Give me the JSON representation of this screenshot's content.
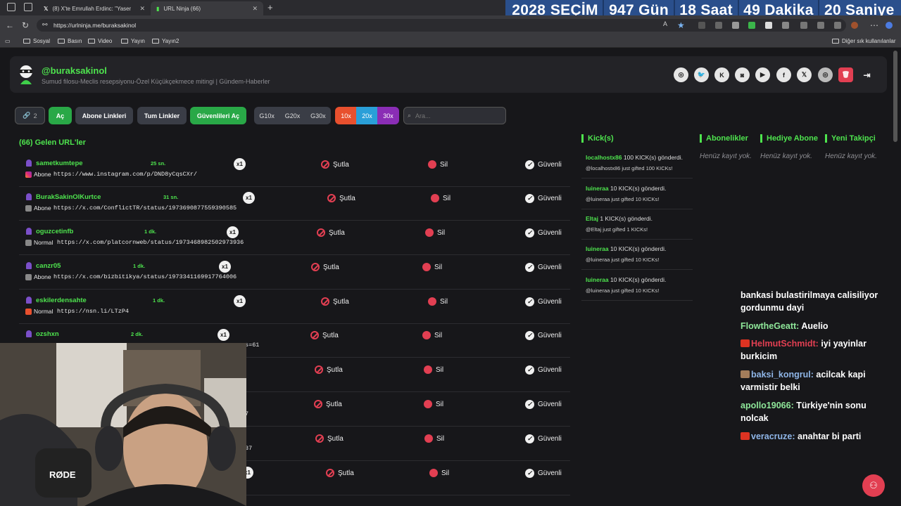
{
  "browser": {
    "tabs": [
      {
        "label": "(8) X'te Emrullah Erdinc: \"Yasemin",
        "active": false
      },
      {
        "label": "URL Ninja (66)",
        "active": true
      }
    ],
    "url": "https://urlninja.me/buraksakinol",
    "bookmarks": [
      "Sosyal",
      "Basın",
      "Video",
      "Yayın",
      "Yayın2"
    ],
    "other_bookmarks": "Diğer sık kullanılanlar"
  },
  "countdown": {
    "year": "2028",
    "label": "SEÇİM",
    "days": "947 Gün",
    "hours": "18 Saat",
    "minutes": "49 Dakika",
    "seconds": "20 Saniye"
  },
  "profile": {
    "username": "@buraksakinol",
    "subtitle": "Sumud filosu-Meclis resepsiyonu-Özel Küçükçekmece mitingi | Gündem-Haberler",
    "social_icons": [
      "dribbble-icon",
      "twitter-icon",
      "kick-icon",
      "instagram-icon",
      "youtube-icon",
      "facebook-icon",
      "x-icon",
      "dribbble-alt-icon",
      "trash-icon",
      "logout-icon"
    ]
  },
  "toolbar": {
    "count": "2",
    "open_label": "Aç",
    "subscriber_links": "Abone Linkleri",
    "all_links": "Tum Linkler",
    "open_safe": "Güvenlileri Aç",
    "g_options": [
      "G10x",
      "G20x",
      "G30x"
    ],
    "multipliers": [
      {
        "label": "10x",
        "color": "#e8502e"
      },
      {
        "label": "20x",
        "color": "#2a9fd8"
      },
      {
        "label": "30x",
        "color": "#8a2db5"
      }
    ],
    "search_placeholder": "Ara..."
  },
  "list": {
    "title": "(66) Gelen URL'ler",
    "actions": {
      "skip": "Şutla",
      "delete": "Sil",
      "safe": "Güvenli"
    },
    "rows": [
      {
        "user": "sametkumtepe",
        "time": "25 sn.",
        "mult": "x1",
        "kind": "Abone",
        "platform": "instagram",
        "url": "https://www.instagram.com/p/DND8yCqsCXr/"
      },
      {
        "user": "BurakSakinOlKurtce",
        "time": "31 sn.",
        "mult": "x1",
        "kind": "Abone",
        "platform": "x",
        "url": "https://x.com/ConflictTR/status/1973690877559390585"
      },
      {
        "user": "oguzcetinfb",
        "time": "1 dk.",
        "mult": "x1",
        "kind": "Normal",
        "platform": "x",
        "url": "https://x.com/platcornweb/status/1973468982502973936"
      },
      {
        "user": "canzr05",
        "time": "1 dk.",
        "mult": "x1",
        "kind": "Abone",
        "platform": "x",
        "url": "https://x.com/bizbitikya/status/1973341169917764006"
      },
      {
        "user": "eskilerdensahte",
        "time": "1 dk.",
        "mult": "x1",
        "kind": "Normal",
        "platform": "instagram",
        "url": "https://nsn.li/LTzP4"
      },
      {
        "user": "ozshxn",
        "time": "2 dk.",
        "mult": "x1",
        "kind": "",
        "platform": "",
        "url": "s=61"
      },
      {
        "user": "",
        "time": "",
        "mult": "",
        "kind": "",
        "platform": "",
        "url": ""
      },
      {
        "user": "",
        "time": "",
        "mult": "",
        "kind": "",
        "platform": "",
        "url": "7"
      },
      {
        "user": "",
        "time": "",
        "mult": "",
        "kind": "",
        "platform": "",
        "url": "37"
      },
      {
        "user": "",
        "time": "",
        "mult": "x1",
        "kind": "",
        "platform": "",
        "url": ""
      }
    ]
  },
  "kicks": {
    "title": "Kick(s)",
    "items": [
      {
        "user": "localhostx86",
        "text": "100 KICK(s) gönderdi.",
        "sub": "@localhostx86 just gifted 100 KICKs!"
      },
      {
        "user": "luineraa",
        "text": "10 KICK(s) gönderdi.",
        "sub": "@luineraa just gifted 10 KICKs!"
      },
      {
        "user": "Eltaj",
        "text": "1 KICK(s) gönderdi.",
        "sub": "@Eltaj just gifted 1 KICKs!"
      },
      {
        "user": "luineraa",
        "text": "10 KICK(s) gönderdi.",
        "sub": "@luineraa just gifted 10 KICKs!"
      },
      {
        "user": "luineraa",
        "text": "10 KICK(s) gönderdi.",
        "sub": "@luineraa just gifted 10 KICKs!"
      }
    ]
  },
  "panels": [
    {
      "title": "Abonelikler",
      "empty": "Henüz kayıt yok."
    },
    {
      "title": "Hediye Abone",
      "empty": "Henüz kayıt yok."
    },
    {
      "title": "Yeni Takipçi",
      "empty": "Henüz kayıt yok."
    }
  ],
  "chat": [
    {
      "name": "",
      "msg": "bankasi bulastirilmaya calisiliyor gordunmu dayi"
    },
    {
      "name": "FlowtheGeatt:",
      "msg": "Auelio"
    },
    {
      "name": "HelmutSchmidt:",
      "msg": "iyi yayinlar burkicim"
    },
    {
      "name": "baksi_kongrul:",
      "msg": "acilcak kapi varmistir belki"
    },
    {
      "name": "apollo19066:",
      "msg": "Türkiye'nin sonu nolcak"
    },
    {
      "name": "veracruze:",
      "msg": "anahtar bi parti"
    }
  ],
  "webcam": {
    "mic_brand": "RØDE"
  }
}
